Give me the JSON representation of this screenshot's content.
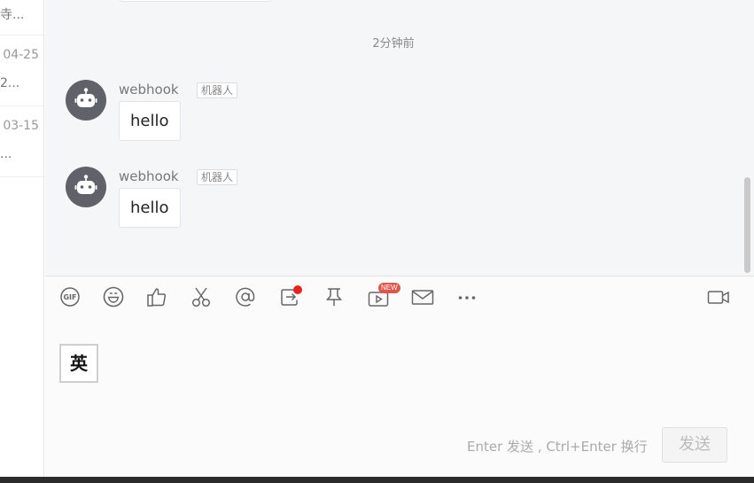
{
  "sidebar": {
    "items": [
      {
        "date": "",
        "preview": "寺..."
      },
      {
        "date": "04-25",
        "preview": "2..."
      },
      {
        "date": "03-15",
        "preview": "..."
      }
    ]
  },
  "chat": {
    "timestamp": "2分钟前",
    "messages": [
      {
        "sender": "webhook",
        "badge": "机器人",
        "text": "hello",
        "avatar_icon": "robot-icon"
      },
      {
        "sender": "webhook",
        "badge": "机器人",
        "text": "hello",
        "avatar_icon": "robot-icon"
      }
    ]
  },
  "toolbar": {
    "items": [
      {
        "name": "gif-icon"
      },
      {
        "name": "emoji-icon"
      },
      {
        "name": "thumbs-up-icon"
      },
      {
        "name": "scissors-icon"
      },
      {
        "name": "at-mention-icon"
      },
      {
        "name": "share-icon"
      },
      {
        "name": "pin-icon"
      },
      {
        "name": "live-video-icon"
      },
      {
        "name": "mail-icon"
      },
      {
        "name": "more-icon"
      },
      {
        "name": "video-call-icon"
      }
    ],
    "new_badge": "NEW"
  },
  "composer": {
    "ime_indicator": "英",
    "hint": "Enter 发送 , Ctrl+Enter 换行",
    "send_label": "发送"
  },
  "colors": {
    "chat_background": "#f5f6f7",
    "avatar": "#5f6369",
    "notification_red": "#e8221d",
    "new_badge": "#e0554a"
  }
}
